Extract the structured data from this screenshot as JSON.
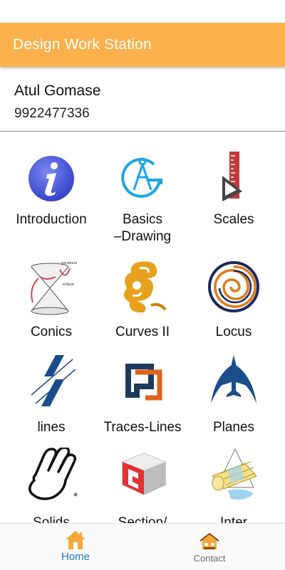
{
  "app_bar": {
    "title": "Design Work Station"
  },
  "profile": {
    "name": "Atul Gomase",
    "phone": "9922477336"
  },
  "grid": {
    "items": [
      {
        "label": "Introduction",
        "icon": "info-icon"
      },
      {
        "label": "Basics\n–Drawing",
        "icon": "compass-icon"
      },
      {
        "label": "Scales",
        "icon": "scale-ruler-icon"
      },
      {
        "label": "Conics",
        "icon": "cone-icon"
      },
      {
        "label": "Curves II",
        "icon": "french-curve-icon"
      },
      {
        "label": "Locus",
        "icon": "spiral-icon"
      },
      {
        "label": "lines",
        "icon": "lines-icon"
      },
      {
        "label": "Traces-Lines",
        "icon": "traces-icon"
      },
      {
        "label": "Planes",
        "icon": "airplane-icon"
      },
      {
        "label": "Solids",
        "icon": "hand-icon"
      },
      {
        "label": "Section/",
        "icon": "section-block-icon"
      },
      {
        "label": "Inter",
        "icon": "intersection-icon"
      }
    ]
  },
  "bottom_nav": {
    "home": {
      "label": "Home",
      "icon": "home-icon"
    },
    "contact": {
      "label": "Contact",
      "icon": "contact-house-icon"
    }
  },
  "colors": {
    "app_bar": "#fbb14b",
    "active_nav": "#1a73c8",
    "nav_icon": "#f5a83a"
  }
}
